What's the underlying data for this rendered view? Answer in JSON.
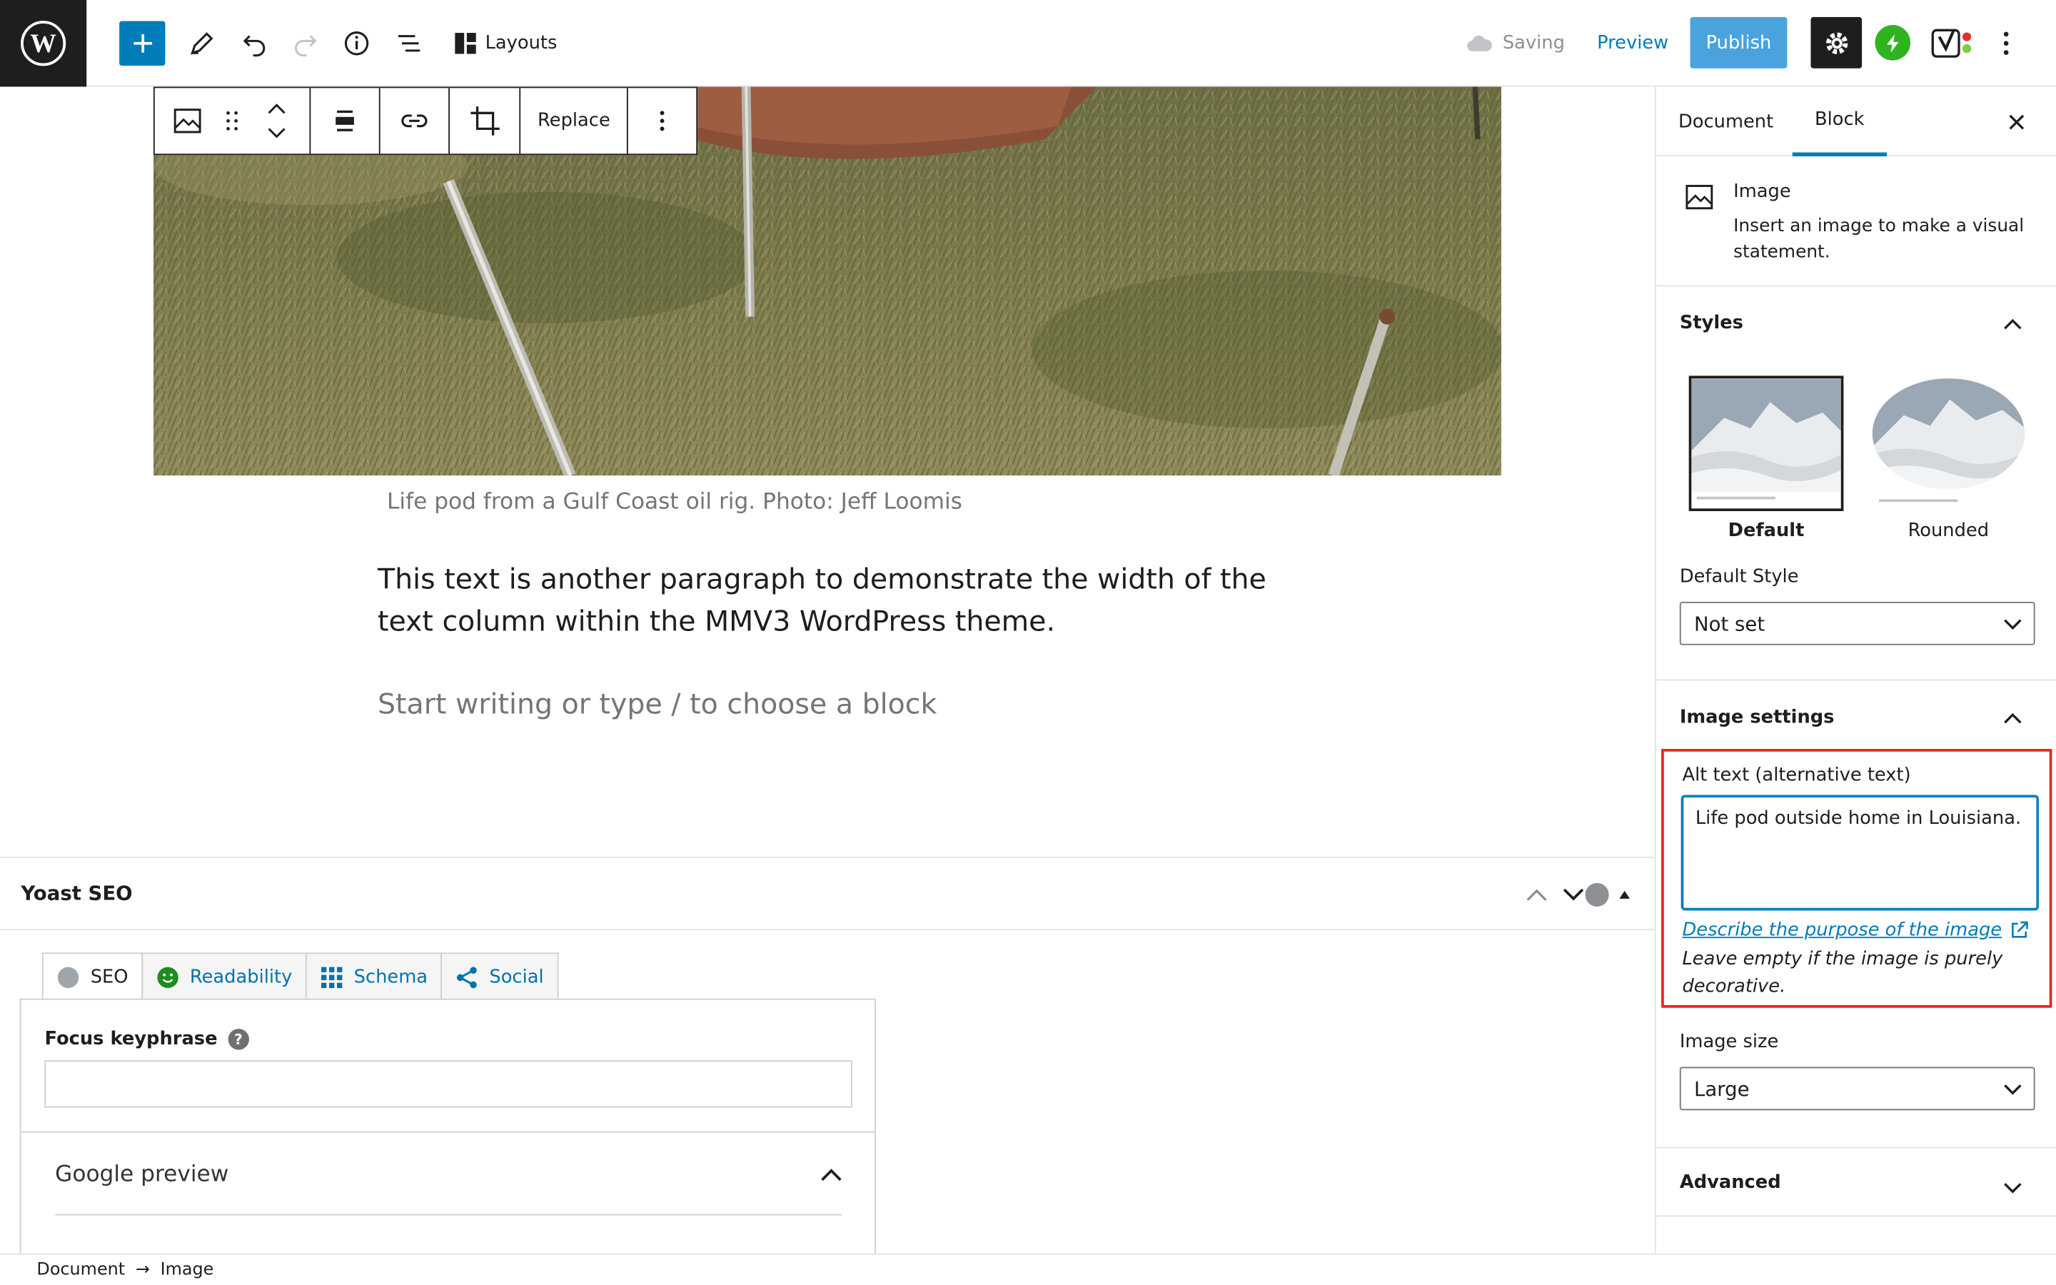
{
  "topbar": {
    "layouts_label": "Layouts",
    "saving_label": "Saving",
    "preview_label": "Preview",
    "publish_label": "Publish"
  },
  "block_toolbar": {
    "replace_label": "Replace"
  },
  "editor": {
    "caption": "Life pod from a Gulf Coast oil rig. Photo: Jeff Loomis",
    "paragraph": "This text is another paragraph to demonstrate the width of the text column within the MMV3 WordPress theme.",
    "placeholder": "Start writing or type / to choose a block"
  },
  "yoast": {
    "title": "Yoast SEO",
    "tabs": [
      {
        "label": "SEO",
        "icon": "seo-status-dot-icon"
      },
      {
        "label": "Readability",
        "icon": "smiley-icon"
      },
      {
        "label": "Schema",
        "icon": "grid-icon"
      },
      {
        "label": "Social",
        "icon": "share-icon"
      }
    ],
    "focus_keyphrase_label": "Focus keyphrase",
    "focus_keyphrase_value": "",
    "google_preview_label": "Google preview"
  },
  "breadcrumb": {
    "items": [
      "Document",
      "Image"
    ],
    "separator": "→"
  },
  "sidebar": {
    "tabs": [
      "Document",
      "Block"
    ],
    "active_tab": "Block",
    "block_card": {
      "title": "Image",
      "description": "Insert an image to make a visual statement."
    },
    "styles": {
      "title": "Styles",
      "options": [
        "Default",
        "Rounded"
      ],
      "selected": "Default",
      "default_style_label": "Default Style",
      "default_style_value": "Not set"
    },
    "image_settings": {
      "title": "Image settings",
      "alt_label": "Alt text (alternative text)",
      "alt_value": "Life pod outside home in Louisiana.",
      "alt_link": "Describe the purpose of the image",
      "alt_help": "Leave empty if the image is purely decorative.",
      "size_label": "Image size",
      "size_value": "Large"
    },
    "advanced_title": "Advanced"
  },
  "colors": {
    "accent": "#007cba",
    "publish_busy": "#4aa3dd",
    "highlight_border": "#e4261e",
    "jetpack_green": "#2fb41f"
  }
}
